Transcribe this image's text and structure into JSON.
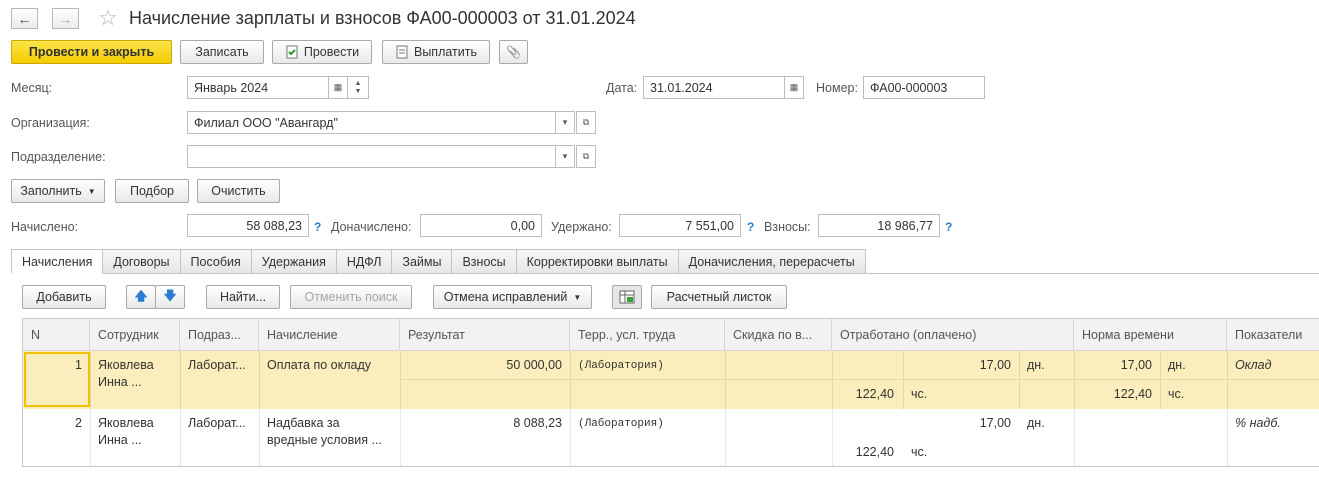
{
  "window": {
    "title": "Начисление зарплаты и взносов ФА00-000003 от 31.01.2024",
    "back_icon": "←",
    "forward_icon": "→",
    "favorite_icon": "☆"
  },
  "toolbar": {
    "post_and_close": "Провести и закрыть",
    "save": "Записать",
    "post": "Провести",
    "pay": "Выплатить",
    "attach_icon": "📎"
  },
  "form": {
    "month_label": "Месяц:",
    "month_value": "Январь 2024",
    "date_label": "Дата:",
    "date_value": "31.01.2024",
    "number_label": "Номер:",
    "number_value": "ФА00-000003",
    "org_label": "Организация:",
    "org_value": "Филиал ООО \"Авангард\"",
    "dept_label": "Подразделение:",
    "dept_value": ""
  },
  "actions": {
    "fill": "Заполнить",
    "select": "Подбор",
    "clear": "Очистить"
  },
  "totals": {
    "accrued_label": "Начислено:",
    "accrued_value": "58 088,23",
    "additional_label": "Доначислено:",
    "additional_value": "0,00",
    "withheld_label": "Удержано:",
    "withheld_value": "7 551,00",
    "contributions_label": "Взносы:",
    "contributions_value": "18 986,77",
    "help_mark": "?"
  },
  "tabs": [
    "Начисления",
    "Договоры",
    "Пособия",
    "Удержания",
    "НДФЛ",
    "Займы",
    "Взносы",
    "Корректировки выплаты",
    "Доначисления, перерасчеты"
  ],
  "table_toolbar": {
    "add": "Добавить",
    "find": "Найти...",
    "cancel_search": "Отменить поиск",
    "undo_corrections": "Отмена исправлений",
    "payslip": "Расчетный листок"
  },
  "table": {
    "columns": [
      "N",
      "Сотрудник",
      "Подраз...",
      "Начисление",
      "Результат",
      "Терр., усл. труда",
      "Скидка по в...",
      "Отработано (оплачено)",
      "Норма времени",
      "Показатели"
    ],
    "rows": [
      {
        "n": "1",
        "employee": [
          "Яковлева",
          "Инна ..."
        ],
        "dept": "Лаборат...",
        "accrual": [
          "Оплата по окладу",
          ""
        ],
        "result": "50 000,00",
        "territory": "(Лаборатория)",
        "discount": "",
        "worked_days": "17,00",
        "worked_days_unit": "дн.",
        "worked_hours": "122,40",
        "worked_hours_unit": "чс.",
        "norm_days": "17,00",
        "norm_days_unit": "дн.",
        "norm_hours": "122,40",
        "norm_hours_unit": "чс.",
        "indicator": "Оклад"
      },
      {
        "n": "2",
        "employee": [
          "Яковлева",
          "Инна ..."
        ],
        "dept": "Лаборат...",
        "accrual": [
          "Надбавка за",
          "вредные условия ..."
        ],
        "result": "8 088,23",
        "territory": "(Лаборатория)",
        "discount": "",
        "worked_days": "17,00",
        "worked_days_unit": "дн.",
        "worked_hours": "122,40",
        "worked_hours_unit": "чс.",
        "norm_days": "",
        "norm_days_unit": "",
        "norm_hours": "",
        "norm_hours_unit": "",
        "indicator": "% надб."
      }
    ]
  }
}
